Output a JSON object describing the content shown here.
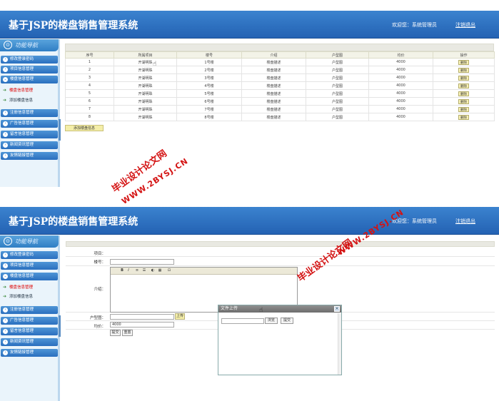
{
  "app": {
    "title": "基于JSP的楼盘销售管理系统",
    "welcome": "欢迎您：系统管理员",
    "logout": "注销退出"
  },
  "sidebar": {
    "nav_label": "功能导航",
    "menu_top": [
      "修改登录密码",
      "项目信息管理",
      "楼盘信息管理"
    ],
    "sub_items": [
      "楼盘信息管理",
      "添加楼盘信息"
    ],
    "menu_bottom": [
      "注册信息管理",
      "广告信息管理",
      "留言信息管理",
      "新闻资讯管理",
      "友情链接管理"
    ]
  },
  "list": {
    "columns": [
      "序号",
      "所属项目",
      "楼号",
      "介绍",
      "户型图",
      "均价",
      "操作"
    ],
    "rows": [
      [
        "1",
        "开湖明珠",
        "1号楼",
        "楼盘描述",
        "户型图",
        "4000",
        "删除"
      ],
      [
        "2",
        "开湖明珠",
        "2号楼",
        "楼盘描述",
        "户型图",
        "4000",
        "删除"
      ],
      [
        "3",
        "开湖明珠",
        "3号楼",
        "楼盘描述",
        "户型图",
        "4000",
        "删除"
      ],
      [
        "4",
        "开湖明珠",
        "4号楼",
        "楼盘描述",
        "户型图",
        "4000",
        "删除"
      ],
      [
        "5",
        "开湖明珠",
        "5号楼",
        "楼盘描述",
        "户型图",
        "4000",
        "删除"
      ],
      [
        "6",
        "开湖明珠",
        "6号楼",
        "楼盘描述",
        "户型图",
        "4000",
        "删除"
      ],
      [
        "7",
        "开湖明珠",
        "7号楼",
        "楼盘描述",
        "户型图",
        "4000",
        "删除"
      ],
      [
        "8",
        "开湖明珠",
        "8号楼",
        "楼盘描述",
        "户型图",
        "4000",
        "删除"
      ]
    ],
    "add_button": "添加楼盘信息"
  },
  "form": {
    "project_label": "项目：",
    "building_label": "楼号：",
    "intro_label": "介绍：",
    "floorplan_label": "户型图：",
    "price_label": "均价：",
    "price_value": "4000",
    "upload_button": "上传",
    "submit_button": "提交",
    "reset_button": "重置",
    "editor_tools": [
      "B",
      "I",
      "≡",
      "☰",
      "◐",
      "▦",
      "⊡"
    ]
  },
  "dialog": {
    "title": "文件上传",
    "browse_button": "浏览",
    "submit_button": "提交"
  },
  "watermark": {
    "cn": "毕业设计论文网",
    "url": "WWW.2BYSJ.CN"
  }
}
